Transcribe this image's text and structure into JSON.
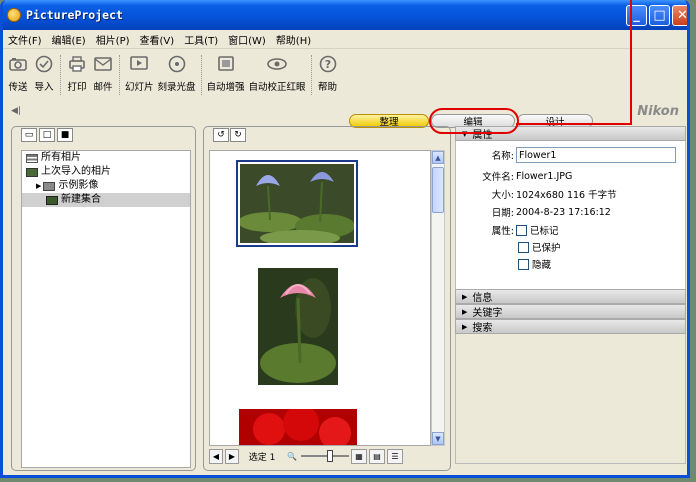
{
  "window": {
    "title": "PictureProject"
  },
  "menu": [
    "文件(F)",
    "编辑(E)",
    "相片(P)",
    "查看(V)",
    "工具(T)",
    "窗口(W)",
    "帮助(H)"
  ],
  "toolbar": [
    {
      "label": "传送",
      "icon": "camera-icon"
    },
    {
      "label": "导入",
      "icon": "import-icon"
    },
    {
      "label": "打印",
      "icon": "printer-icon"
    },
    {
      "label": "邮件",
      "icon": "mail-icon"
    },
    {
      "label": "幻灯片",
      "icon": "slideshow-icon"
    },
    {
      "label": "刻录光盘",
      "icon": "disc-icon"
    },
    {
      "label": "自动增强",
      "icon": "enhance-icon"
    },
    {
      "label": "自动校正红眼",
      "icon": "eye-icon"
    },
    {
      "label": "帮助",
      "icon": "help-icon"
    }
  ],
  "brand": "Nikon",
  "modes": [
    "整理",
    "编辑",
    "设计"
  ],
  "active_mode": "整理",
  "tree": [
    {
      "label": "所有相片",
      "icon": "all-photos-icon"
    },
    {
      "label": "上次导入的相片",
      "icon": "last-import-icon"
    },
    {
      "label": "示例影像",
      "icon": "folder-icon"
    },
    {
      "label": "新建集合",
      "icon": "collection-icon"
    }
  ],
  "bottom": {
    "selected_label": "选定 1"
  },
  "properties": {
    "header": "属性",
    "name_label": "名称:",
    "name_value": "Flower1",
    "filename_label": "文件名:",
    "filename_value": "Flower1.JPG",
    "size_label": "大小:",
    "size_value": "1024x680  116 千字节",
    "date_label": "日期:",
    "date_value": "2004-8-23 17:16:12",
    "attr_label": "属性:",
    "checkboxes": [
      "已标记",
      "已保护",
      "隐藏"
    ]
  },
  "sections": [
    "信息",
    "关键字",
    "搜索"
  ],
  "colors": {
    "accent_red": "#e00000",
    "title_blue": "#0552d8",
    "active_tab": "#f0c800"
  }
}
